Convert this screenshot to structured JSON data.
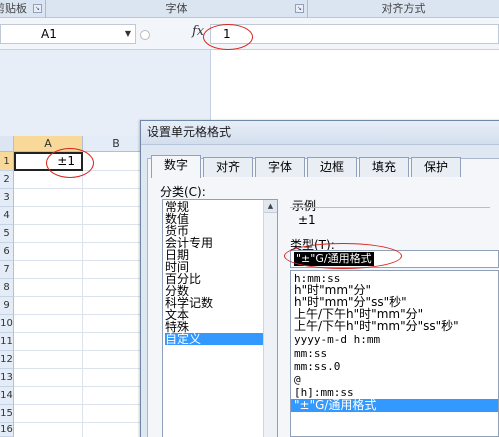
{
  "ribbon": {
    "groups": [
      {
        "label": "剪贴板"
      },
      {
        "label": "字体"
      },
      {
        "label": "对齐方式"
      }
    ]
  },
  "formula_bar": {
    "name_box": "A1",
    "fx": "fx",
    "value": "1"
  },
  "grid": {
    "columns": [
      "A",
      "B"
    ],
    "rows": [
      "1",
      "2",
      "3",
      "4",
      "5",
      "6",
      "7",
      "8",
      "9",
      "10",
      "11",
      "12",
      "13",
      "14",
      "15",
      "16"
    ],
    "a1_display": "±1"
  },
  "dialog": {
    "title": "设置单元格格式",
    "tabs": [
      "数字",
      "对齐",
      "字体",
      "边框",
      "填充",
      "保护"
    ],
    "category_label": "分类(C):",
    "categories": [
      "常规",
      "数值",
      "货币",
      "会计专用",
      "日期",
      "时间",
      "百分比",
      "分数",
      "科学记数",
      "文本",
      "特殊",
      "自定义"
    ],
    "selected_category": "自定义",
    "sample_label": "示例",
    "sample_value": "±1",
    "type_label": "类型(T):",
    "type_value": "\"±\"G/通用格式",
    "formats": [
      "h:mm:ss",
      "h\"时\"mm\"分\"",
      "h\"时\"mm\"分\"ss\"秒\"",
      "上午/下午h\"时\"mm\"分\"",
      "上午/下午h\"时\"mm\"分\"ss\"秒\"",
      "yyyy-m-d h:mm",
      "mm:ss",
      "mm:ss.0",
      "@",
      "[h]:mm:ss",
      "\"±\"G/通用格式"
    ]
  },
  "colors": {
    "selection": "#3399ff",
    "annotation": "#d9251d",
    "ribbon": "#dbe5f2"
  }
}
